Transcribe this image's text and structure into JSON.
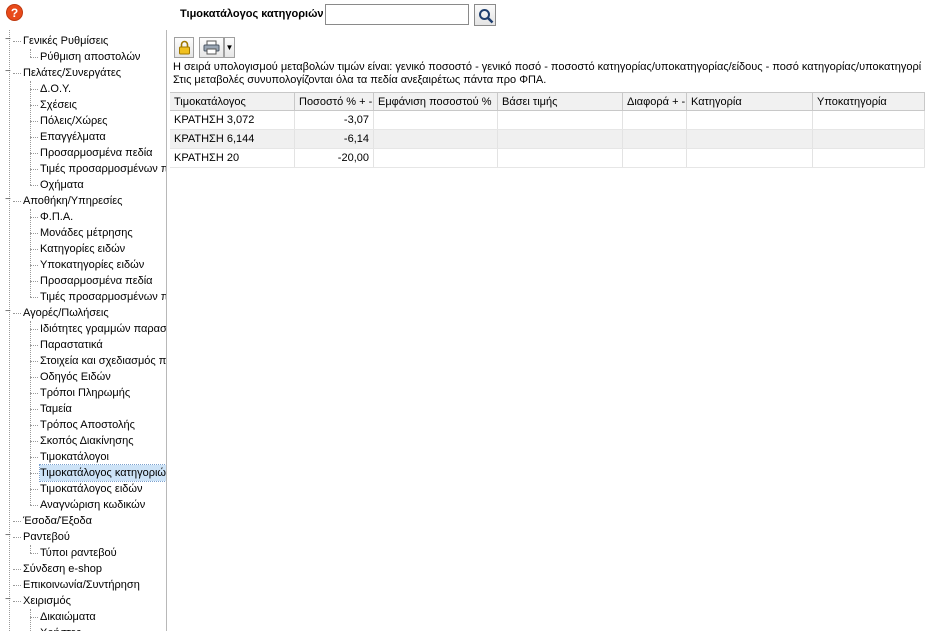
{
  "header": {
    "title": "Τιμοκατάλογος κατηγοριών",
    "search_value": "",
    "help_glyph": "?"
  },
  "icons": {
    "help": "help-icon",
    "search": "search-icon",
    "lock": "lock-icon",
    "print": "printer-icon",
    "dropdown": "chevron-down-icon"
  },
  "info": {
    "line1": "Η σειρά υπολογισμού μεταβολών τιμών είναι: γενικό ποσοστό - γενικό ποσό - ποσοστό κατηγορίας/υποκατηγορίας/είδους - ποσό κατηγορίας/υποκατηγορί",
    "line2": "Στις μεταβολές συνυπολογίζονται όλα τα πεδία ανεξαιρέτως πάντα προ ΦΠΑ."
  },
  "tree": {
    "groups": [
      {
        "label": "Γενικές Ρυθμίσεις",
        "children": [
          "Ρύθμιση αποστολών"
        ]
      },
      {
        "label": "Πελάτες/Συνεργάτες",
        "children": [
          "Δ.Ο.Υ.",
          "Σχέσεις",
          "Πόλεις/Χώρες",
          "Επαγγέλματα",
          "Προσαρμοσμένα πεδία",
          "Τιμές προσαρμοσμένων π",
          "Οχήματα"
        ]
      },
      {
        "label": "Αποθήκη/Υπηρεσίες",
        "children": [
          "Φ.Π.Α.",
          "Μονάδες μέτρησης",
          "Κατηγορίες ειδών",
          "Υποκατηγορίες ειδών",
          "Προσαρμοσμένα πεδία",
          "Τιμές προσαρμοσμένων π"
        ]
      },
      {
        "label": "Αγορές/Πωλήσεις",
        "children": [
          "Ιδιότητες γραμμών παραστ",
          "Παραστατικά",
          "Στοιχεία και σχεδιασμός π",
          "Οδηγός Ειδών",
          "Τρόποι Πληρωμής",
          "Ταμεία",
          "Τρόπος Αποστολής",
          "Σκοπός Διακίνησης",
          "Τιμοκατάλογοι",
          "Τιμοκατάλογος κατηγοριώ",
          "Τιμοκατάλογος ειδών",
          "Αναγνώριση κωδικών"
        ]
      },
      {
        "label": "Έσοδα/Έξοδα",
        "children": []
      },
      {
        "label": "Ραντεβού",
        "children": [
          "Τύποι ραντεβού"
        ]
      },
      {
        "label": "Σύνδεση e-shop",
        "children": []
      },
      {
        "label": "Επικοινωνία/Συντήρηση",
        "children": []
      },
      {
        "label": "Χειρισμός",
        "children": [
          "Δικαιώματα",
          "Χρήστες"
        ]
      }
    ],
    "selected": "Τιμοκατάλογος κατηγοριώ"
  },
  "grid": {
    "columns": [
      "Τιμοκατάλογος",
      "Ποσοστό % + -",
      "Εμφάνιση ποσοστού %",
      "Βάσει τιμής",
      "Διαφορά + -",
      "Κατηγορία",
      "Υποκατηγορία"
    ],
    "rows": [
      [
        "ΚΡΑΤΗΣΗ 3,072",
        "-3,07",
        "",
        "",
        "",
        "",
        ""
      ],
      [
        "ΚΡΑΤΗΣΗ 6,144",
        "-6,14",
        "",
        "",
        "",
        "",
        ""
      ],
      [
        "ΚΡΑΤΗΣΗ 20",
        "-20,00",
        "",
        "",
        "",
        "",
        ""
      ]
    ]
  }
}
